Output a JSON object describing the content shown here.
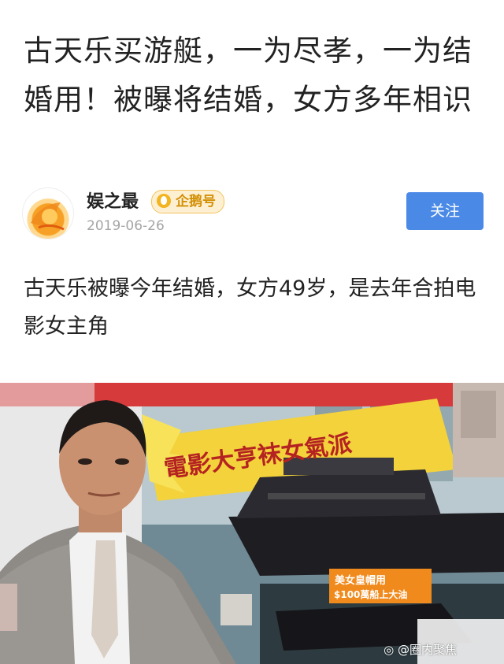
{
  "article": {
    "title": "古天乐买游艇，一为尽孝，一为结婚用！被曝将结婚，女方多年相识",
    "subtitle": "古天乐被曝今年结婚，女方49岁，是去年合拍电影女主角"
  },
  "author": {
    "name": "娱之最",
    "badge": "企鹅号",
    "date": "2019-06-26",
    "follow_label": "关注"
  },
  "photo": {
    "banner_text": "電影大亨袜女氣派",
    "caption_line1": "美女皇帽用",
    "caption_line2": "$100萬船上大油",
    "watermark": "@圈内聚焦"
  },
  "colors": {
    "accent": "#4a8ae6",
    "badge_bg": "#fdf0d2",
    "badge_text": "#d39007"
  }
}
